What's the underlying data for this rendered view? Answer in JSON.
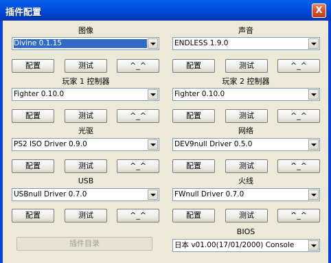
{
  "window": {
    "title": "插件配置",
    "close_label": "X"
  },
  "sections": [
    {
      "id": "graphics",
      "label": "图像",
      "value": "Divine  0.1.15",
      "selected": true,
      "buttons": [
        "配置",
        "测试",
        "^_^"
      ]
    },
    {
      "id": "sound",
      "label": "声音",
      "value": "ENDLESS 1.9.0",
      "selected": false,
      "buttons": [
        "配置",
        "测试",
        "^_^"
      ]
    },
    {
      "id": "pad1",
      "label": "玩家 1 控制器",
      "value": "Fighter 0.10.0",
      "selected": false,
      "buttons": [
        "配置",
        "测试",
        "^_^"
      ]
    },
    {
      "id": "pad2",
      "label": "玩家 2 控制器",
      "value": "Fighter 0.10.0",
      "selected": false,
      "buttons": [
        "配置",
        "测试",
        "^_^"
      ]
    },
    {
      "id": "cdvd",
      "label": "光驱",
      "value": "PS2 ISO Driver 0.9.0",
      "selected": false,
      "buttons": [
        "配置",
        "测试",
        "^_^"
      ]
    },
    {
      "id": "dev9",
      "label": "网络",
      "value": "DEV9null Driver 0.5.0",
      "selected": false,
      "buttons": [
        "配置",
        "测试",
        "^_^"
      ]
    },
    {
      "id": "usb",
      "label": "USB",
      "value": "USBnull Driver 0.7.0",
      "selected": false,
      "buttons": [
        "配置",
        "测试",
        "^_^"
      ]
    },
    {
      "id": "fw",
      "label": "火线",
      "value": "FWnull Driver 0.7.0",
      "selected": false,
      "buttons": [
        "配置",
        "测试",
        "^_^"
      ]
    }
  ],
  "bios": {
    "label": "BIOS",
    "value": "日本   v01.00(17/01/2000) Console"
  },
  "plugins_dir_button": "插件目录"
}
